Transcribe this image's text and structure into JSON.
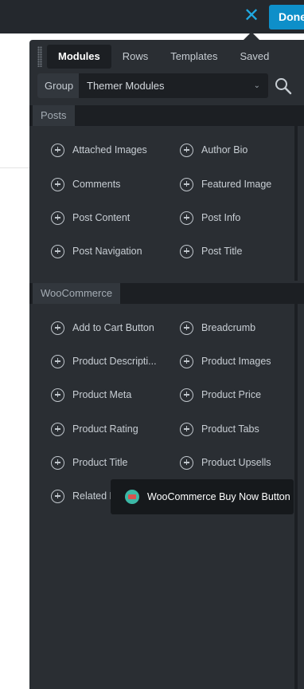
{
  "topbar": {
    "done_label": "Done",
    "close_icon": "✕"
  },
  "tabs": [
    {
      "label": "Modules",
      "active": true
    },
    {
      "label": "Rows",
      "active": false
    },
    {
      "label": "Templates",
      "active": false
    },
    {
      "label": "Saved",
      "active": false
    }
  ],
  "group": {
    "label": "Group",
    "value": "Themer Modules",
    "chevron": "⌄"
  },
  "sections": {
    "posts": {
      "title": "Posts",
      "modules": [
        "Attached Images",
        "Author Bio",
        "Comments",
        "Featured Image",
        "Post Content",
        "Post Info",
        "Post Navigation",
        "Post Title"
      ]
    },
    "woocommerce": {
      "title": "WooCommerce",
      "modules": [
        "Add to Cart Button",
        "Breadcrumb",
        "Product Descripti...",
        "Product Images",
        "Product Meta",
        "Product Price",
        "Product Rating",
        "Product Tabs",
        "Product Title",
        "Product Upsells",
        "Related P"
      ]
    }
  },
  "tooltip": {
    "text": "WooCommerce Buy Now Button"
  },
  "colors": {
    "accent": "#1fa9e1",
    "done_bg": "#0e8fc9",
    "panel": "#2a2e33",
    "dark": "#1c1f23"
  },
  "icons": {
    "close": "close-icon",
    "search": "search-icon",
    "plus": "plus-circle-icon",
    "drag": "drag-handle-icon"
  }
}
